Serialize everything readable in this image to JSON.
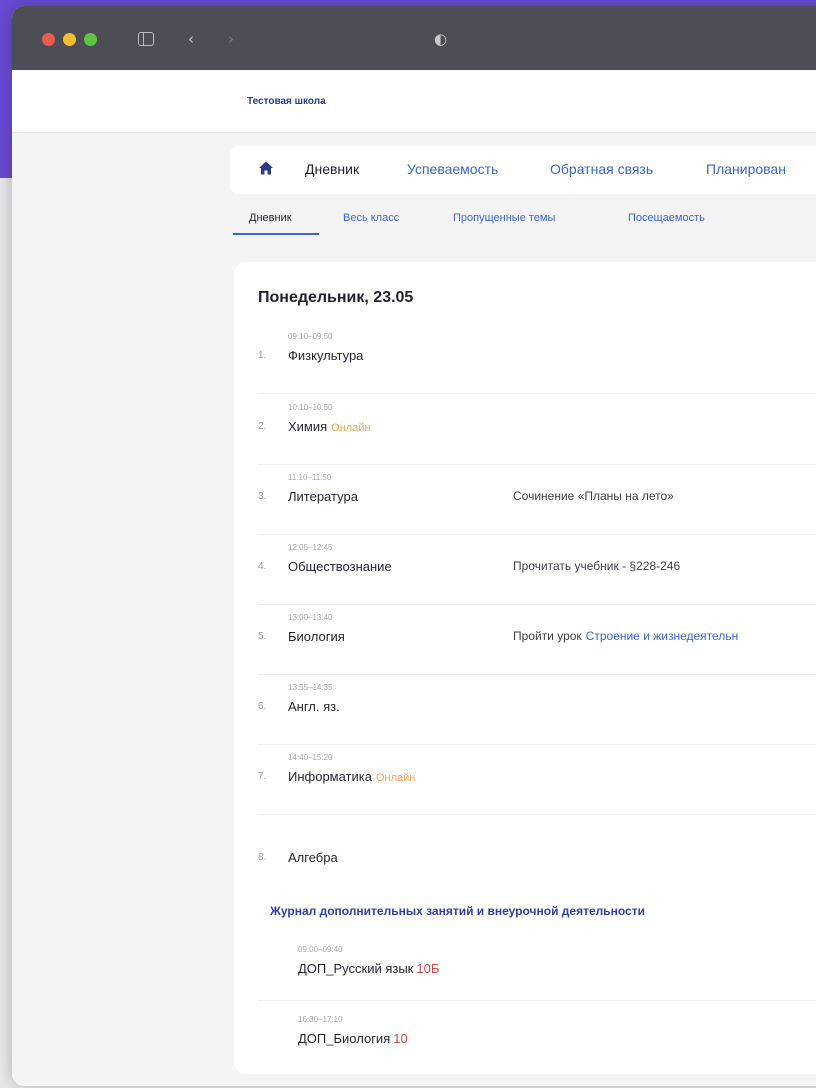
{
  "browser": {
    "icons": [
      "sidebar-toggle-icon",
      "back-chevron-icon",
      "forward-chevron-icon",
      "shield-icon"
    ],
    "back_glyph": "‹",
    "forward_glyph": "›",
    "shield_glyph": "◐"
  },
  "school": {
    "name": "Тестовая школа"
  },
  "main_nav": {
    "items": [
      {
        "label": "Дневник",
        "active": true
      },
      {
        "label": "Успеваемость"
      },
      {
        "label": "Обратная связь"
      },
      {
        "label": "Планирован"
      }
    ]
  },
  "sub_nav": {
    "items": [
      {
        "label": "Дневник",
        "active": true
      },
      {
        "label": "Весь класс"
      },
      {
        "label": "Пропущенные темы"
      },
      {
        "label": "Посещаемость"
      }
    ]
  },
  "day": {
    "title": "Понедельник, 23.05",
    "lessons": [
      {
        "num": "1.",
        "time": "09:10–09:50",
        "subject": "Физкультура",
        "online": "",
        "homework": "",
        "homework_link": ""
      },
      {
        "num": "2.",
        "time": "10:10–10:50",
        "subject": "Химия",
        "online": "Онлайн",
        "homework": "",
        "homework_link": ""
      },
      {
        "num": "3.",
        "time": "11:10–11:50",
        "subject": "Литература",
        "online": "",
        "homework": "Сочинение «Планы на лето»",
        "homework_link": ""
      },
      {
        "num": "4.",
        "time": "12:05–12:45",
        "subject": "Обществознание",
        "online": "",
        "homework": "Прочитать учебник - §228-246",
        "homework_link": ""
      },
      {
        "num": "5.",
        "time": "13:00–13:40",
        "subject": "Биология",
        "online": "",
        "homework": "Пройти урок",
        "homework_link": "Строение и жизнедеятельн"
      },
      {
        "num": "6.",
        "time": "13:55–14:35",
        "subject": "Англ. яз.",
        "online": "",
        "homework": "",
        "homework_link": ""
      },
      {
        "num": "7.",
        "time": "14:40–15:20",
        "subject": "Информатика",
        "online": "Онлайн",
        "homework": "",
        "homework_link": ""
      },
      {
        "num": "8.",
        "time": "",
        "subject": "Алгебра",
        "online": "",
        "homework": "",
        "homework_link": ""
      }
    ]
  },
  "journal": {
    "title": "Журнал дополнительных занятий и внеурочной деятельности",
    "items": [
      {
        "time": "09:00–09:40",
        "subject": "ДОП_Русский язык",
        "group": "10Б"
      },
      {
        "time": "16:30–17:10",
        "subject": "ДОП_Биология",
        "group": "10"
      }
    ]
  },
  "colors": {
    "accent_blue": "#3a66c9",
    "online_orange": "#f2a44a",
    "group_red": "#d74646",
    "brand_purple": "#6a4bd8"
  }
}
